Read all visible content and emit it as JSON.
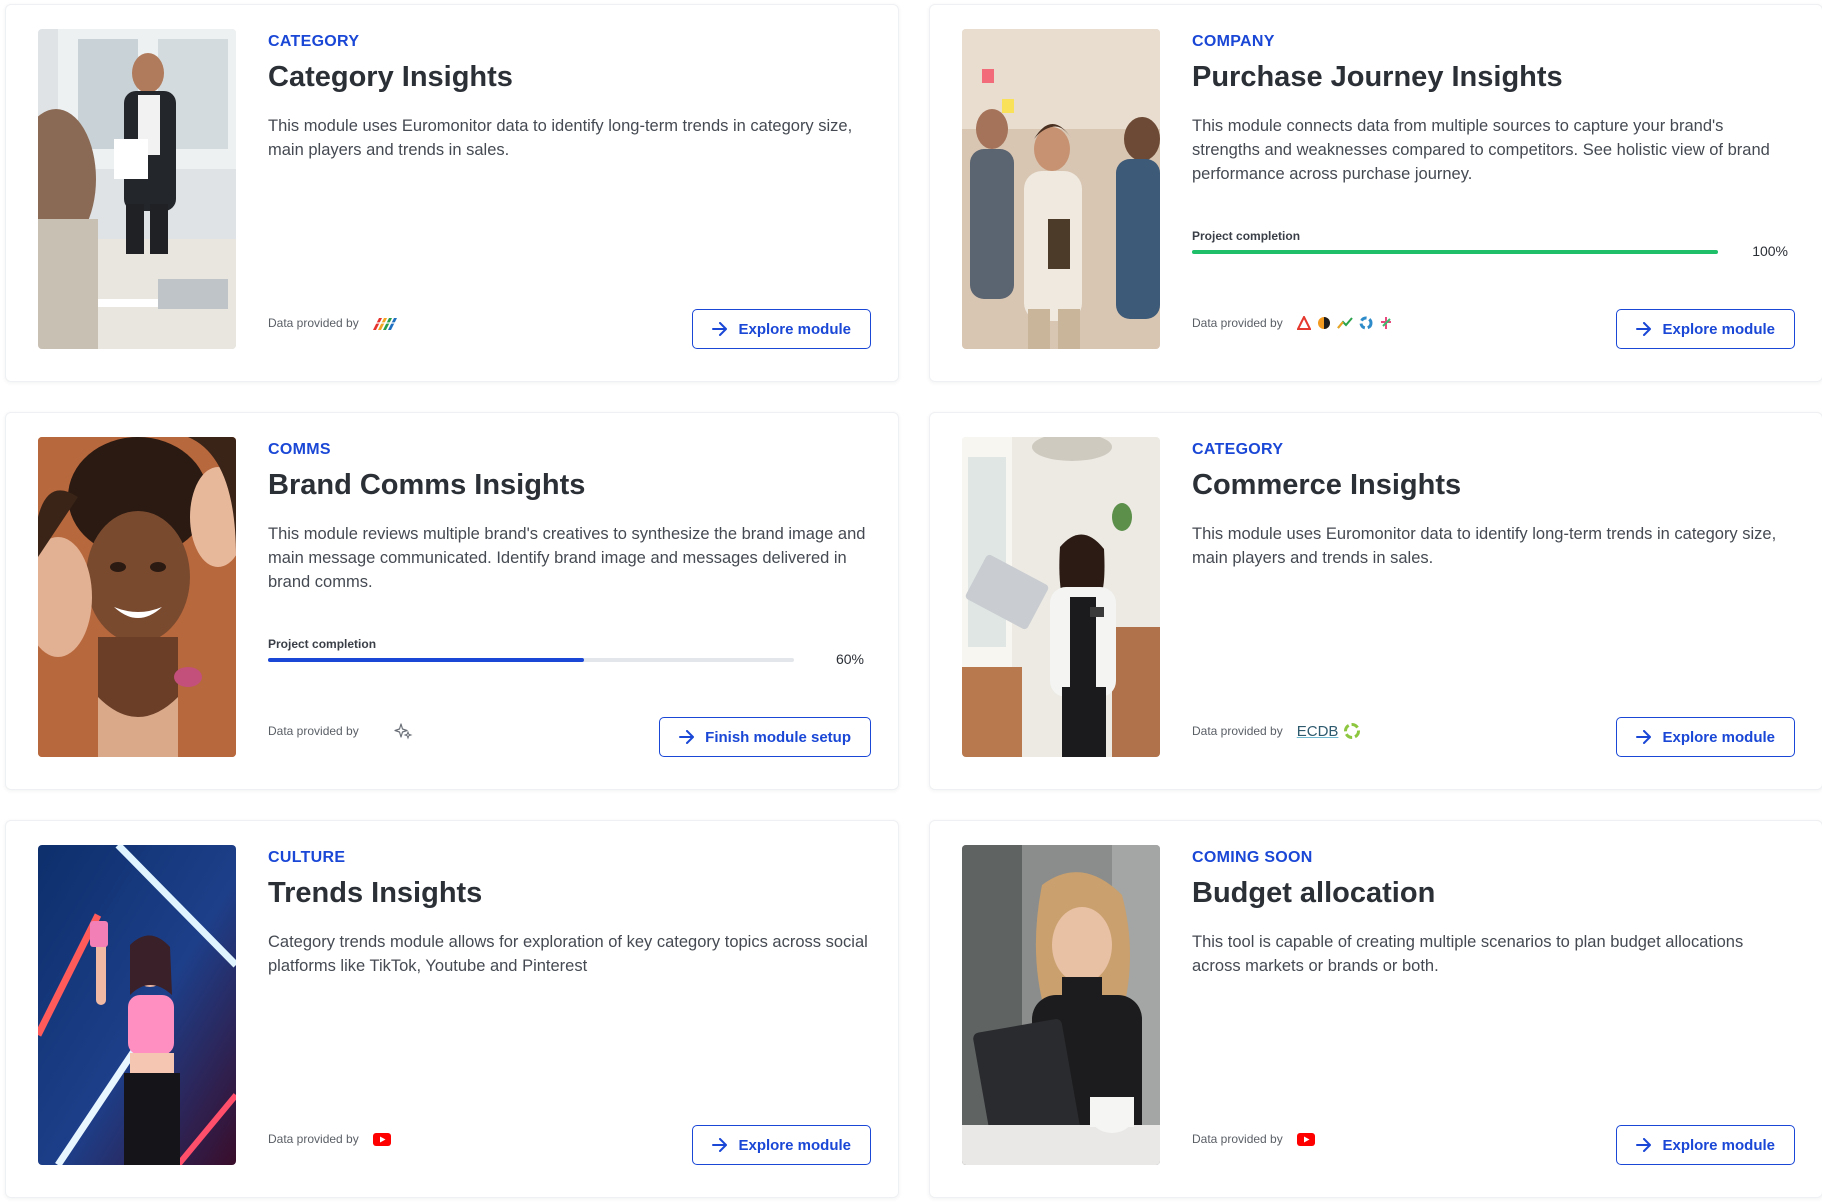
{
  "colors": {
    "accent": "#1a47d6",
    "progress_complete": "#1fbf6a",
    "progress_partial": "#1a47d6",
    "track": "#e3e6ea"
  },
  "provider_label": "Data provided by",
  "cards": [
    {
      "category": "CATEGORY",
      "title": "Category Insights",
      "description": "This module uses Euromonitor data to identify long-term trends in category size, main players and trends in sales.",
      "provider_logo": "euromonitor-logo",
      "button_label": "Explore module",
      "button_icon": "arrow-right-icon"
    },
    {
      "category": "COMPANY",
      "title": "Purchase Journey Insights",
      "description": "This module connects data from multiple sources to capture your brand's strengths and weaknesses compared to competitors. See holistic view of brand performance across purchase journey.",
      "progress": {
        "label": "Project completion",
        "value": 100,
        "text": "100%"
      },
      "provider_logo": "multiple-provider-logos",
      "button_label": "Explore module",
      "button_icon": "arrow-right-icon"
    },
    {
      "category": "COMMS",
      "title": "Brand Comms Insights",
      "description": "This module reviews multiple brand's creatives to synthesize the brand image and main message communicated. Identify brand image and messages delivered in brand comms.",
      "progress": {
        "label": "Project completion",
        "value": 60,
        "text": "60%"
      },
      "provider_logo": "sparkle-icon",
      "button_label": "Finish module setup",
      "button_icon": "arrow-right-icon"
    },
    {
      "category": "CATEGORY",
      "title": "Commerce Insights",
      "description": "This module uses Euromonitor data to identify long-term trends in category size, main players and trends in sales.",
      "provider_logo": "ecdb-logo",
      "provider_logo_text": "ECDB",
      "button_label": "Explore module",
      "button_icon": "arrow-right-icon"
    },
    {
      "category": "CULTURE",
      "title": "Trends Insights",
      "description": "Category trends module allows for exploration of key category topics across social platforms like TikTok, Youtube and Pinterest",
      "provider_logo": "youtube-logo",
      "button_label": "Explore module",
      "button_icon": "arrow-right-icon"
    },
    {
      "category": "COMING SOON",
      "title": "Budget allocation",
      "description": "This tool is capable of creating multiple scenarios to plan budget allocations across markets or brands or both.",
      "provider_logo": "youtube-logo",
      "button_label": "Explore module",
      "button_icon": "arrow-right-icon"
    }
  ]
}
